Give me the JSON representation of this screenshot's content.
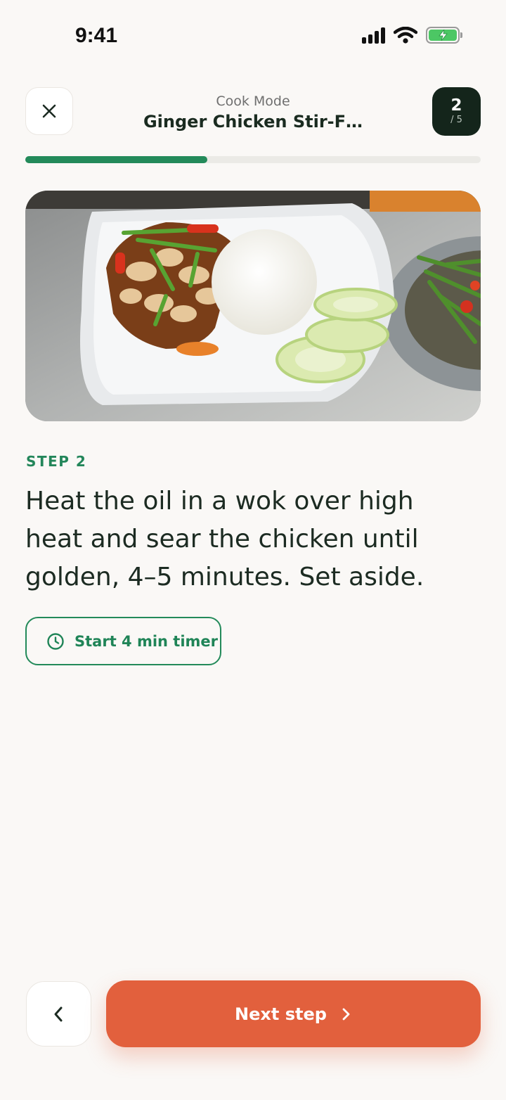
{
  "status_bar": {
    "time": "9:41"
  },
  "header": {
    "subtitle": "Cook Mode",
    "title": "Ginger Chicken Stir-F…",
    "step_current": "2",
    "step_total": "/ 5"
  },
  "progress": {
    "fraction": 0.4
  },
  "step": {
    "label": "STEP 2",
    "instruction": "Heat the oil in a wok over high heat and sear the chicken until golden, 4–5 minutes. Set aside.",
    "timer_label": "Start 4 min timer"
  },
  "footer": {
    "next_label": "Next step"
  },
  "colors": {
    "accent_green": "#238a5a",
    "primary_orange": "#e2603d",
    "badge_dark": "#14251b",
    "background": "#faf8f6"
  },
  "icons": [
    "close-icon",
    "clock-icon",
    "chevron-left-icon",
    "chevron-right-icon",
    "signal-icon",
    "wifi-icon",
    "battery-icon"
  ]
}
